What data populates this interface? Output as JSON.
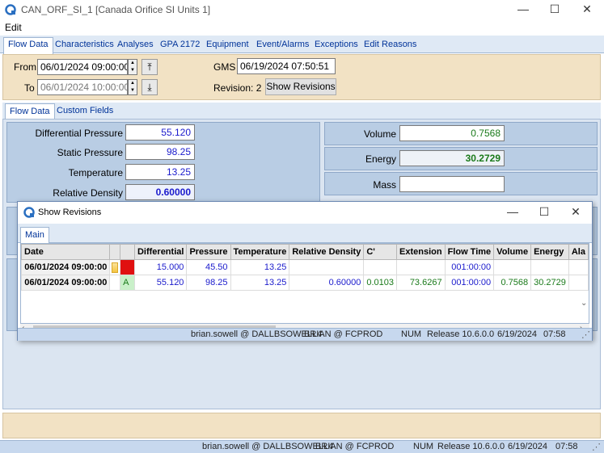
{
  "window": {
    "title": "CAN_ORF_SI_1 [Canada Orifice SI Units 1]",
    "minimize": "—",
    "maximize": "☐",
    "close": "✕"
  },
  "menu": {
    "edit": "Edit"
  },
  "top_tabs": [
    "Flow Data",
    "Characteristics",
    "Analyses",
    "GPA 2172",
    "Equipment",
    "Event/Alarms",
    "Exceptions",
    "Edit Reasons"
  ],
  "header": {
    "from_label": "From",
    "from_value": "06/01/2024 09:00:00",
    "to_label": "To",
    "to_value": "06/01/2024 10:00:00",
    "gms_label": "GMS",
    "gms_value": "06/19/2024 07:50:51",
    "revision_label": "Revision: 2",
    "show_revisions_label": "Show Revisions"
  },
  "inner_tabs": [
    "Flow Data",
    "Custom Fields"
  ],
  "flow": {
    "differential_pressure_label": "Differential Pressure",
    "differential_pressure_value": "55.120",
    "static_pressure_label": "Static Pressure",
    "static_pressure_value": "98.25",
    "temperature_label": "Temperature",
    "temperature_value": "13.25",
    "relative_density_label": "Relative Density",
    "relative_density_value": "0.60000",
    "volume_label": "Volume",
    "volume_value": "0.7568",
    "energy_label": "Energy",
    "energy_value": "30.2729",
    "mass_label": "Mass",
    "mass_value": ""
  },
  "status": {
    "user": "brian.sowell @ DALLBSOWELL4",
    "db": "BRIAN @ FCPROD",
    "num": "NUM",
    "release": "Release 10.6.0.0",
    "date": "6/19/2024",
    "time": "07:58"
  },
  "dialog": {
    "title": "Show Revisions",
    "minimize": "—",
    "maximize": "☐",
    "close": "✕",
    "tab": "Main",
    "columns": [
      "Date",
      "",
      "",
      "Differential",
      "Pressure",
      "Temperature",
      "Relative Density",
      "C'",
      "Extension",
      "Flow Time",
      "Volume",
      "Energy",
      "Ala"
    ],
    "rows": [
      {
        "date": "06/01/2024 09:00:00",
        "flag": "",
        "code": "",
        "differential": "15.000",
        "pressure": "45.50",
        "temperature": "13.25",
        "relative_density": "",
        "c_prime": "",
        "extension": "",
        "flow_time": "001:00:00",
        "volume": "",
        "energy": "",
        "alarm": ""
      },
      {
        "date": "06/01/2024 09:00:00",
        "flag": "",
        "code": "A",
        "differential": "55.120",
        "pressure": "98.25",
        "temperature": "13.25",
        "relative_density": "0.60000",
        "c_prime": "0.0103",
        "extension": "73.6267",
        "flow_time": "001:00:00",
        "volume": "0.7568",
        "energy": "30.2729",
        "alarm": ""
      }
    ]
  },
  "colors": {
    "header_bg": "#f2e2c4",
    "panel_bg": "#dbe5f1",
    "flag_yellow": "#f5c542",
    "flag_red": "#e01010",
    "code_green": "#c9f0c9"
  }
}
